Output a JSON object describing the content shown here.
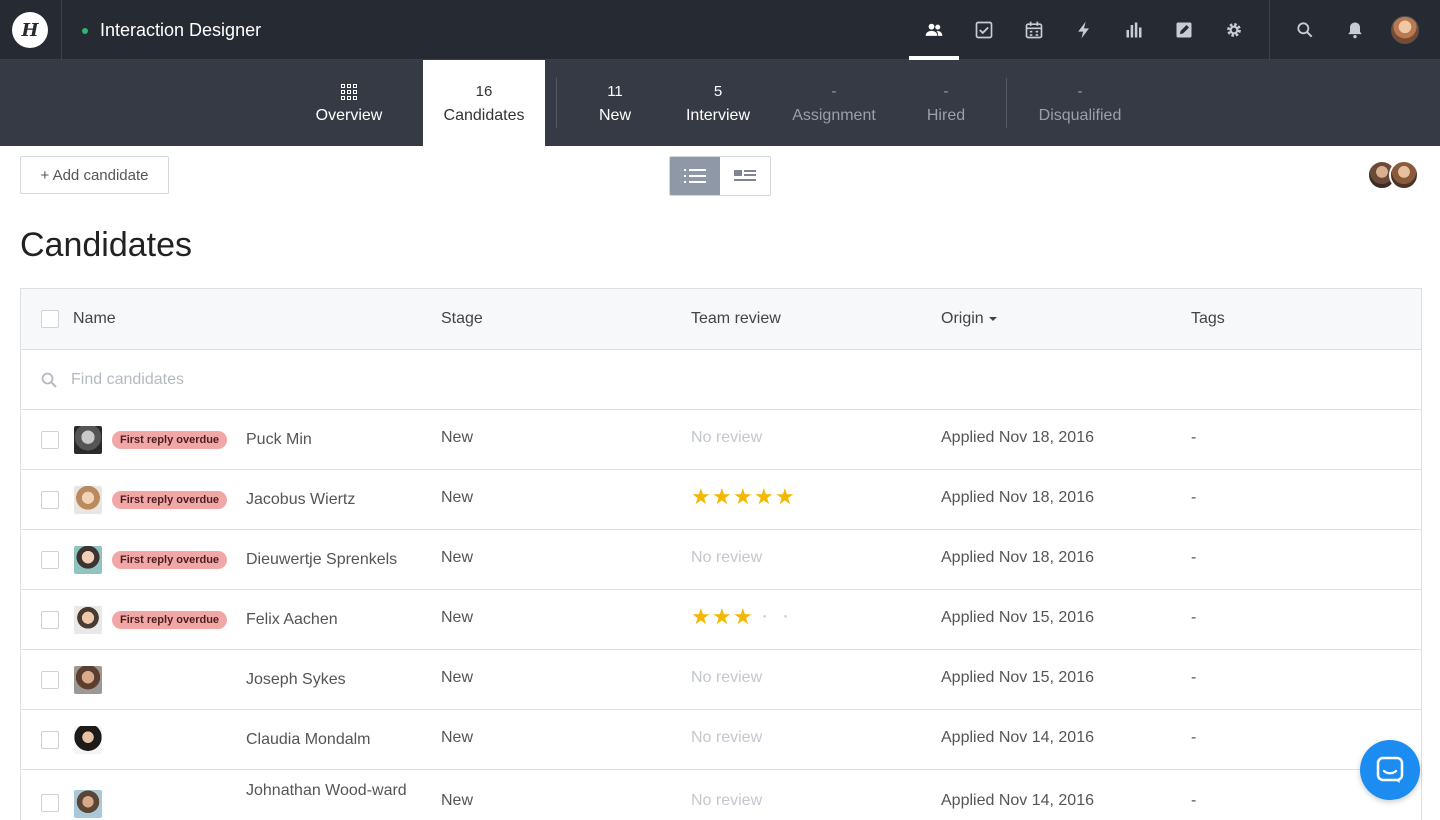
{
  "app": {
    "logo_letter": "H",
    "job_title": "Interaction Designer",
    "nav_icons": [
      "people-icon",
      "checkbox-icon",
      "calendar-icon",
      "lightning-icon",
      "bar-chart-icon",
      "edit-icon",
      "gear-icon"
    ],
    "right_icons": [
      "search-icon",
      "bell-icon"
    ]
  },
  "stages": [
    {
      "count": "",
      "label": "Overview"
    },
    {
      "count": "16",
      "label": "Candidates"
    },
    {
      "count": "11",
      "label": "New"
    },
    {
      "count": "5",
      "label": "Interview"
    },
    {
      "count": "-",
      "label": "Assignment"
    },
    {
      "count": "-",
      "label": "Hired"
    },
    {
      "count": "-",
      "label": "Disqualified"
    }
  ],
  "toolbar": {
    "add_label": "+ Add candidate",
    "view_modes": [
      "list-view-icon",
      "card-view-icon"
    ],
    "active_view": "list"
  },
  "page": {
    "title": "Candidates"
  },
  "table": {
    "columns": [
      "Name",
      "Stage",
      "Team review",
      "Origin",
      "Tags"
    ],
    "origin_sort_icon": "caret-down-icon",
    "search_placeholder": "Find candidates",
    "rows": [
      {
        "badge": "First reply overdue",
        "name": "Puck Min",
        "stage": "New",
        "review": "No review",
        "rating": 0,
        "origin": "Applied Nov 18, 2016",
        "tags": "-"
      },
      {
        "badge": "First reply overdue",
        "name": "Jacobus Wiertz",
        "stage": "New",
        "review": "",
        "rating": 5,
        "origin": "Applied Nov 18, 2016",
        "tags": "-"
      },
      {
        "badge": "First reply overdue",
        "name": "Dieuwertje Sprenkels",
        "stage": "New",
        "review": "No review",
        "rating": 0,
        "origin": "Applied Nov 18, 2016",
        "tags": "-"
      },
      {
        "badge": "First reply overdue",
        "name": "Felix Aachen",
        "stage": "New",
        "review": "",
        "rating": 3,
        "origin": "Applied Nov 15, 2016",
        "tags": "-"
      },
      {
        "badge": "",
        "name": "Joseph Sykes",
        "stage": "New",
        "review": "No review",
        "rating": 0,
        "origin": "Applied Nov 15, 2016",
        "tags": "-"
      },
      {
        "badge": "",
        "name": "Claudia Mondalm",
        "stage": "New",
        "review": "No review",
        "rating": 0,
        "origin": "Applied Nov 14, 2016",
        "tags": "-"
      },
      {
        "badge": "",
        "name": "Johnathan Wood-ward",
        "stage": "New",
        "review": "No review",
        "rating": 0,
        "origin": "Applied Nov 14, 2016",
        "tags": "-"
      }
    ]
  },
  "colors": {
    "topbar": "#262a33",
    "stagebar": "#353a45",
    "badge": "#f2a7a7",
    "star": "#f5b800",
    "chat": "#1d8cf0",
    "status_dot": "#2bb673"
  },
  "chat": {
    "icon": "chat-icon"
  }
}
